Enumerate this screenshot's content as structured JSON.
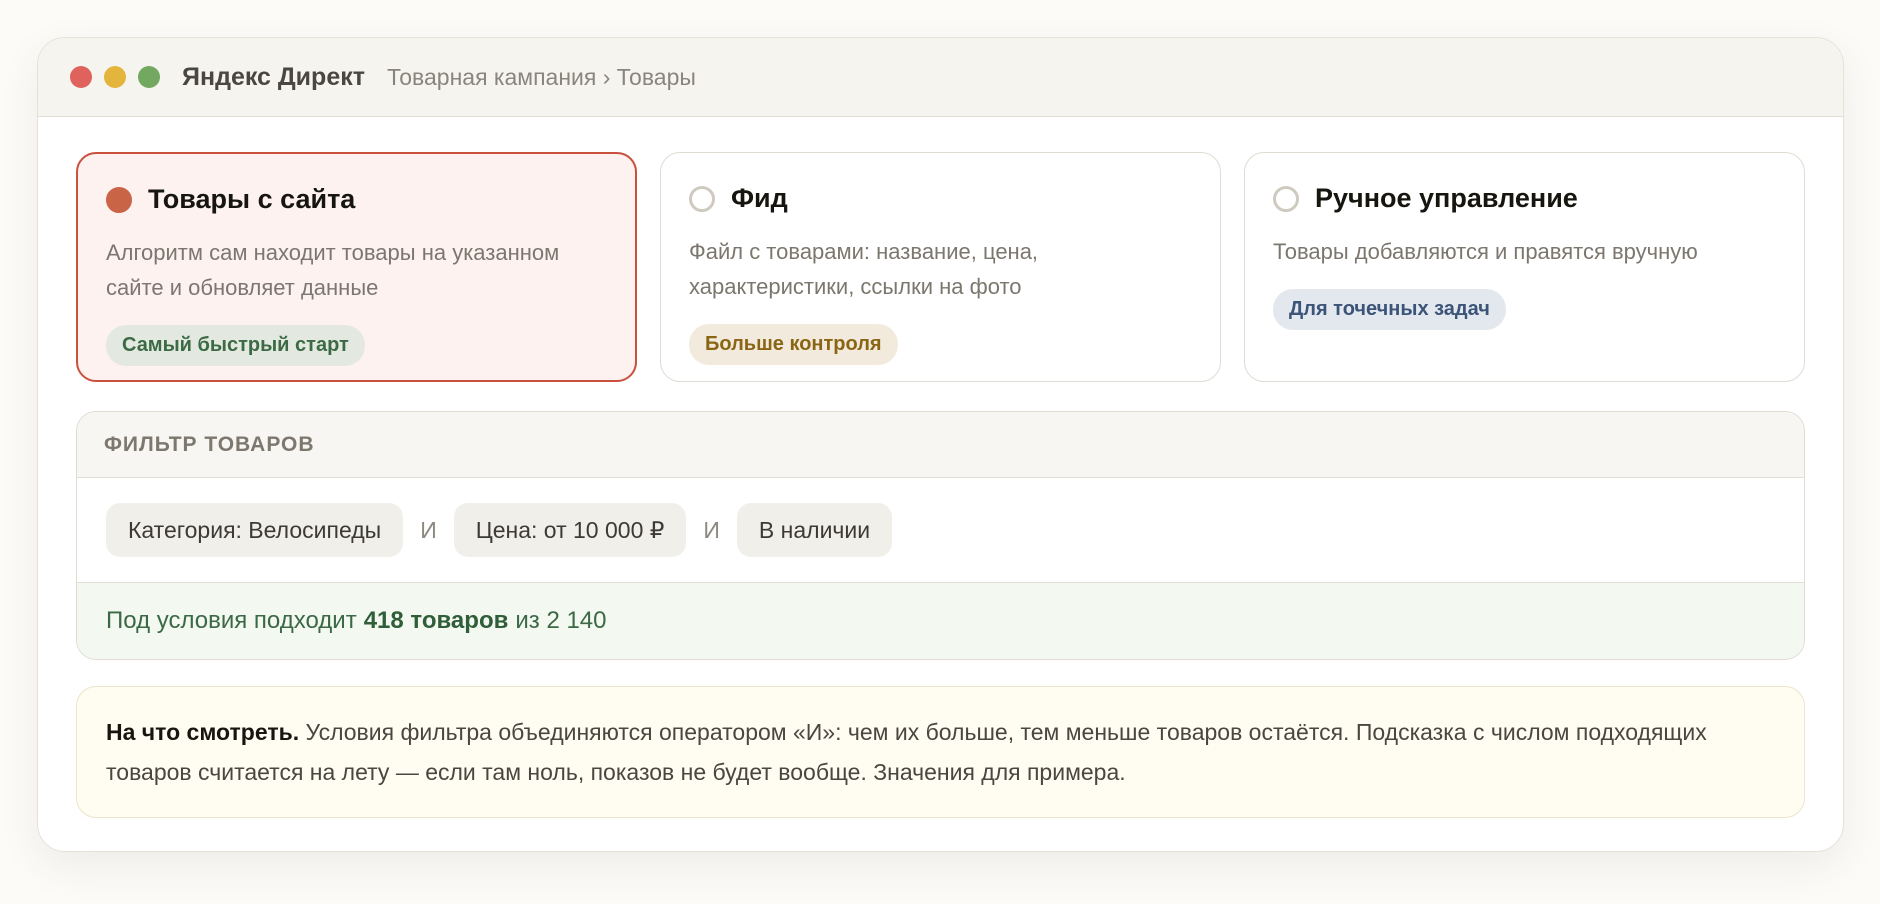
{
  "window": {
    "app_title": "Яндекс Директ",
    "breadcrumb": "Товарная кампания › Товары"
  },
  "options": [
    {
      "title": "Товары с сайта",
      "description": "Алгоритм сам находит товары на указанном сайте и обновляет данные",
      "badge": "Самый быстрый старт",
      "selected": true
    },
    {
      "title": "Фид",
      "description": "Файл с товарами: название, цена, характеристики, ссылки на фото",
      "badge": "Больше контроля",
      "selected": false
    },
    {
      "title": "Ручное управление",
      "description": "Товары добавляются и правятся вручную",
      "badge": "Для точечных задач",
      "selected": false
    }
  ],
  "filter": {
    "header": "ФИЛЬТР ТОВАРОВ",
    "conditions": [
      "Категория: Велосипеды",
      "Цена: от 10 000 ₽",
      "В наличии"
    ],
    "operator": "И",
    "result_prefix": "Под условия подходит",
    "result_count": "418 товаров",
    "result_suffix": "из 2 140"
  },
  "note": {
    "lead": "На что смотреть.",
    "text": "Условия фильтра объединяются оператором «И»: чем их больше, тем меньше товаров остаётся. Подсказка с числом подходящих товаров считается на лету — если там ноль, показов не будет вообще. Значения для примера."
  },
  "colors": {
    "accent": "#c96447",
    "selected_border": "#c9523f",
    "selected_bg": "#fdf2f0",
    "result_green": "#3b6945"
  }
}
